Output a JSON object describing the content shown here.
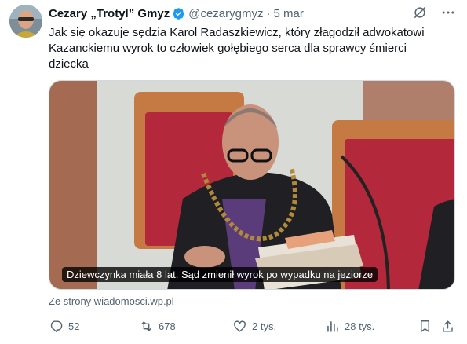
{
  "tweet": {
    "display_name": "Cezary „Trotyl” Gmyz",
    "handle": "@cezarygmyz",
    "separator": "·",
    "time": "5 mar",
    "text": "Jak się okazuje sędzia Karol Radaszkiewicz, który złagodził adwokatowi Kazanckiemu wyrok to człowiek gołębiego serca dla sprawcy śmierci dziecka",
    "verified": true
  },
  "media": {
    "caption": "Dziewczynka miała 8 lat. Sąd zmienił wyrok po wypadku na jeziorze",
    "source": "Ze strony wiadomosci.wp.pl"
  },
  "actions": {
    "replies": "52",
    "retweets": "678",
    "likes": "2 tys.",
    "views": "28 tys."
  },
  "colors": {
    "text": "#0f1419",
    "secondary": "#536471",
    "verified": "#1d9bf0"
  },
  "icons": [
    "verified-badge-icon",
    "grok-icon",
    "more-icon",
    "reply-icon",
    "retweet-icon",
    "like-icon",
    "views-icon",
    "bookmark-icon",
    "share-icon"
  ]
}
